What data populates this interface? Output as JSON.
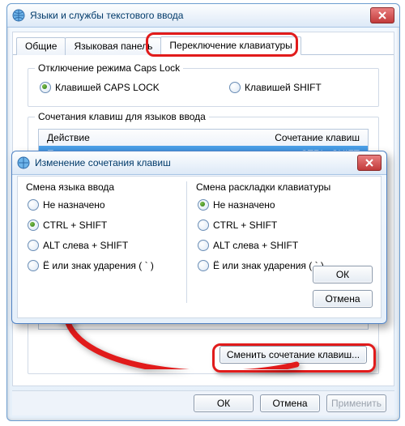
{
  "main": {
    "title": "Языки и службы текстового ввода",
    "tabs": [
      "Общие",
      "Языковая панель",
      "Переключение клавиатуры"
    ],
    "active_tab": 2,
    "caps": {
      "legend": "Отключение режима Caps Lock",
      "opt_caps": "Клавишей CAPS LOCK",
      "opt_shift": "Клавишей SHIFT"
    },
    "hotkeys": {
      "legend": "Сочетания клавиш для языков ввода",
      "col_action": "Действие",
      "col_keys": "Сочетание клавиш",
      "row_action": "Переключить язык ввода",
      "row_keys": "CTRL+SHIFT",
      "change_btn": "Сменить сочетание клавиш..."
    },
    "ok": "ОК",
    "cancel": "Отмена",
    "apply": "Применить"
  },
  "modal": {
    "title": "Изменение сочетания клавиш",
    "lang": {
      "heading": "Смена языка ввода",
      "opt0": "Не назначено",
      "opt1": "CTRL + SHIFT",
      "opt2": "ALT слева + SHIFT",
      "opt3": "Ё или знак ударения ( ` )",
      "selected": 1
    },
    "layout": {
      "heading": "Смена раскладки клавиатуры",
      "opt0": "Не назначено",
      "opt1": "CTRL + SHIFT",
      "opt2": "ALT слева + SHIFT",
      "opt3": "Ё или знак ударения ( ` )",
      "selected": 0
    },
    "ok": "ОК",
    "cancel": "Отмена"
  }
}
